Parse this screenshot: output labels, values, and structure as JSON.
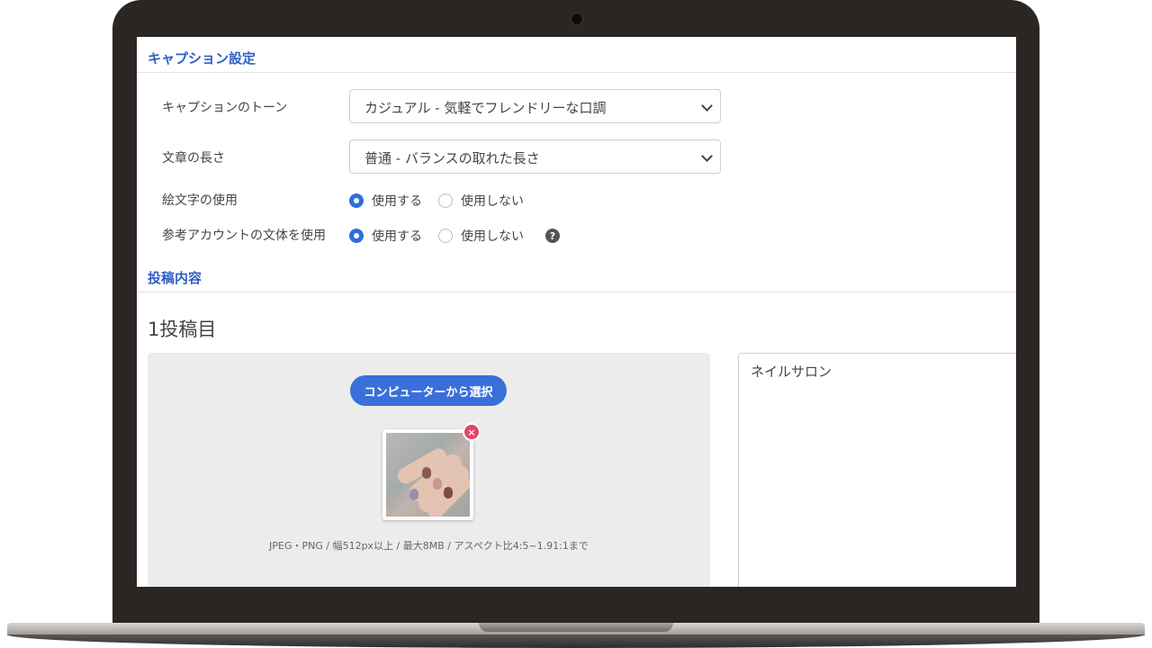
{
  "caption_settings": {
    "title": "キャプション設定",
    "tone": {
      "label": "キャプションのトーン",
      "value": "カジュアル - 気軽でフレンドリーな口調"
    },
    "length": {
      "label": "文章の長さ",
      "value": "普通 - バランスの取れた長さ"
    },
    "emoji": {
      "label": "絵文字の使用",
      "options": [
        "使用する",
        "使用しない"
      ],
      "selected": "使用する"
    },
    "reference_style": {
      "label": "参考アカウントの文体を使用",
      "options": [
        "使用する",
        "使用しない"
      ],
      "selected": "使用する",
      "help_icon": "question-circle-icon"
    }
  },
  "post_content": {
    "title": "投稿内容",
    "post_heading": "1投稿目",
    "upload": {
      "button_label": "コンピューターから選択",
      "remove_icon": "close-icon",
      "remove_glyph": "×",
      "hint": "JPEG・PNG / 幅512px以上 / 最大8MB / アスペクト比4:5~1.91:1まで"
    },
    "text": {
      "value": "ネイルサロン"
    }
  },
  "colors": {
    "accent": "#2f6fde",
    "section_title": "#2f5fc4",
    "remove": "#e0456a"
  }
}
